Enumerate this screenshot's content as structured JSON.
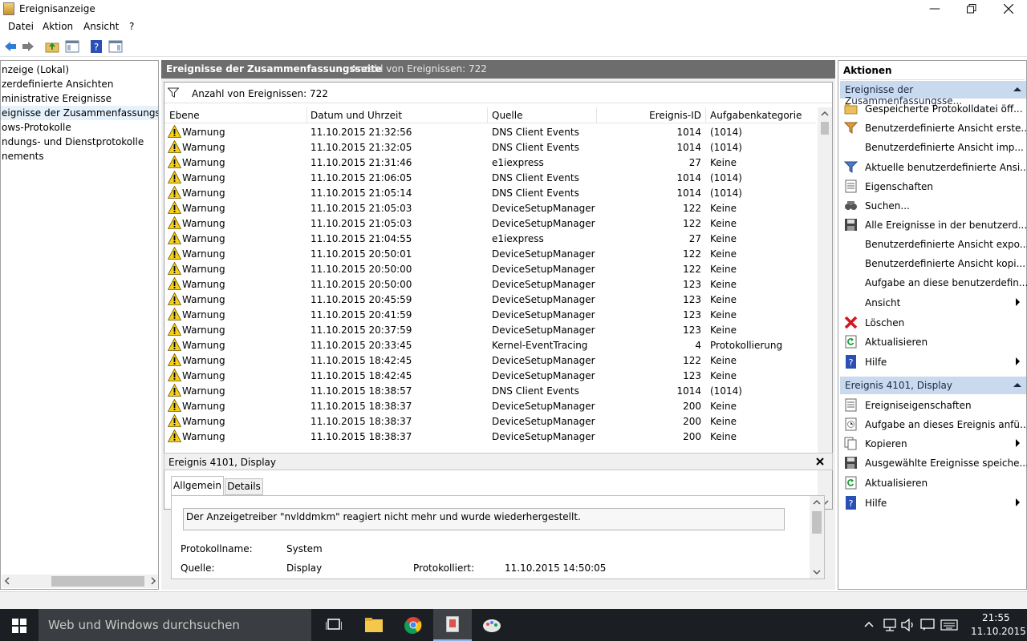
{
  "window": {
    "title": "Ereignisanzeige"
  },
  "menu": [
    "Datei",
    "Aktion",
    "Ansicht",
    "?"
  ],
  "tree": [
    "nzeige (Lokal)",
    "zerdefinierte Ansichten",
    "ministrative Ereignisse",
    "eignisse der Zusammenfassungsseite",
    "ows-Protokolle",
    "ndungs- und Dienstprotokolle",
    "nements"
  ],
  "center": {
    "header_title": "Ereignisse der Zusammenfassungsseite",
    "header_count": "Anzahl von Ereignissen: 722",
    "filter_text": "Anzahl von Ereignissen: 722",
    "columns": [
      "Ebene",
      "Datum und Uhrzeit",
      "Quelle",
      "Ereignis-ID",
      "Aufgabenkategorie"
    ],
    "rows": [
      [
        "Warnung",
        "11.10.2015 21:32:56",
        "DNS Client Events",
        "1014",
        "(1014)"
      ],
      [
        "Warnung",
        "11.10.2015 21:32:05",
        "DNS Client Events",
        "1014",
        "(1014)"
      ],
      [
        "Warnung",
        "11.10.2015 21:31:46",
        "e1iexpress",
        "27",
        "Keine"
      ],
      [
        "Warnung",
        "11.10.2015 21:06:05",
        "DNS Client Events",
        "1014",
        "(1014)"
      ],
      [
        "Warnung",
        "11.10.2015 21:05:14",
        "DNS Client Events",
        "1014",
        "(1014)"
      ],
      [
        "Warnung",
        "11.10.2015 21:05:03",
        "DeviceSetupManager",
        "122",
        "Keine"
      ],
      [
        "Warnung",
        "11.10.2015 21:05:03",
        "DeviceSetupManager",
        "122",
        "Keine"
      ],
      [
        "Warnung",
        "11.10.2015 21:04:55",
        "e1iexpress",
        "27",
        "Keine"
      ],
      [
        "Warnung",
        "11.10.2015 20:50:01",
        "DeviceSetupManager",
        "122",
        "Keine"
      ],
      [
        "Warnung",
        "11.10.2015 20:50:00",
        "DeviceSetupManager",
        "122",
        "Keine"
      ],
      [
        "Warnung",
        "11.10.2015 20:50:00",
        "DeviceSetupManager",
        "123",
        "Keine"
      ],
      [
        "Warnung",
        "11.10.2015 20:45:59",
        "DeviceSetupManager",
        "123",
        "Keine"
      ],
      [
        "Warnung",
        "11.10.2015 20:41:59",
        "DeviceSetupManager",
        "123",
        "Keine"
      ],
      [
        "Warnung",
        "11.10.2015 20:37:59",
        "DeviceSetupManager",
        "123",
        "Keine"
      ],
      [
        "Warnung",
        "11.10.2015 20:33:45",
        "Kernel-EventTracing",
        "4",
        "Protokollierung"
      ],
      [
        "Warnung",
        "11.10.2015 18:42:45",
        "DeviceSetupManager",
        "122",
        "Keine"
      ],
      [
        "Warnung",
        "11.10.2015 18:42:45",
        "DeviceSetupManager",
        "123",
        "Keine"
      ],
      [
        "Warnung",
        "11.10.2015 18:38:57",
        "DNS Client Events",
        "1014",
        "(1014)"
      ],
      [
        "Warnung",
        "11.10.2015 18:38:37",
        "DeviceSetupManager",
        "200",
        "Keine"
      ],
      [
        "Warnung",
        "11.10.2015 18:38:37",
        "DeviceSetupManager",
        "200",
        "Keine"
      ],
      [
        "Warnung",
        "11.10.2015 18:38:37",
        "DeviceSetupManager",
        "200",
        "Keine"
      ]
    ]
  },
  "detail": {
    "title": "Ereignis 4101, Display",
    "tabs": [
      "Allgemein",
      "Details"
    ],
    "message": "Der Anzeigetreiber \"nvlddmkm\" reagiert nicht mehr und wurde wiederhergestellt.",
    "protokollname_label": "Protokollname:",
    "protokollname_value": "System",
    "quelle_label": "Quelle:",
    "quelle_value": "Display",
    "protokolliert_label": "Protokolliert:",
    "protokolliert_value": "11.10.2015 14:50:05"
  },
  "actions": {
    "title": "Aktionen",
    "section1": "Ereignisse der Zusammenfassungsse...",
    "items1": [
      "Gespeicherte Protokolldatei öff...",
      "Benutzerdefinierte Ansicht erste...",
      "Benutzerdefinierte Ansicht imp...",
      "Aktuelle benutzerdefinierte Ansi...",
      "Eigenschaften",
      "Suchen...",
      "Alle Ereignisse in der benutzerd...",
      "Benutzerdefinierte Ansicht expo...",
      "Benutzerdefinierte Ansicht kopi...",
      "Aufgabe an diese benutzerdefin...",
      "Ansicht",
      "Löschen",
      "Aktualisieren",
      "Hilfe"
    ],
    "section2": "Ereignis 4101, Display",
    "items2": [
      "Ereigniseigenschaften",
      "Aufgabe an dieses Ereignis anfü...",
      "Kopieren",
      "Ausgewählte Ereignisse speiche...",
      "Aktualisieren",
      "Hilfe"
    ]
  },
  "taskbar": {
    "search_placeholder": "Web und Windows durchsuchen",
    "time": "21:55",
    "date": "11.10.2015"
  }
}
